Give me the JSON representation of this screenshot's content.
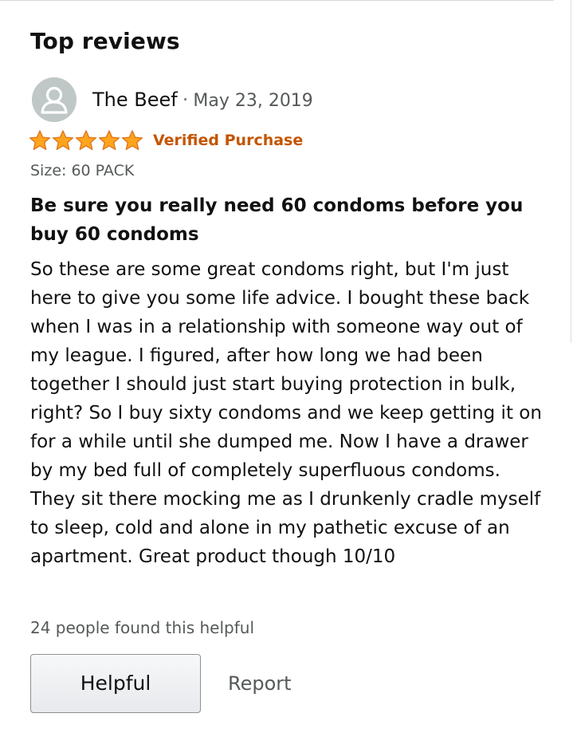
{
  "section": {
    "title": "Top reviews"
  },
  "review": {
    "author": "The Beef",
    "separator": "·",
    "date": "May 23, 2019",
    "rating": 5,
    "rating_max": 5,
    "verified_label": "Verified Purchase",
    "size_label": "Size: 60 PACK",
    "title": "Be sure you really need 60 condoms before you buy 60 condoms",
    "body": "So these are some great condoms right, but I'm just here to give you some life advice. I bought these back when I was in a relationship with someone way out of my league. I figured, after how long we had been together I should just start buying protection in bulk, right? So I buy sixty condoms and we keep getting it on for a while until she dumped me. Now I have a drawer by my bed full of completely superfluous condoms. They sit there mocking me as I drunkenly cradle myself to sleep, cold and alone in my pathetic excuse of an apartment. Great product though 10/10",
    "helpful_count_text": "24 people found this helpful"
  },
  "actions": {
    "helpful_label": "Helpful",
    "report_label": "Report"
  },
  "icons": {
    "avatar": "user-avatar-icon",
    "star": "star-icon"
  },
  "colors": {
    "star_fill": "#ffa41c",
    "star_stroke": "#de7921",
    "verified": "#c45500",
    "avatar_bg": "#bfc7c7"
  }
}
